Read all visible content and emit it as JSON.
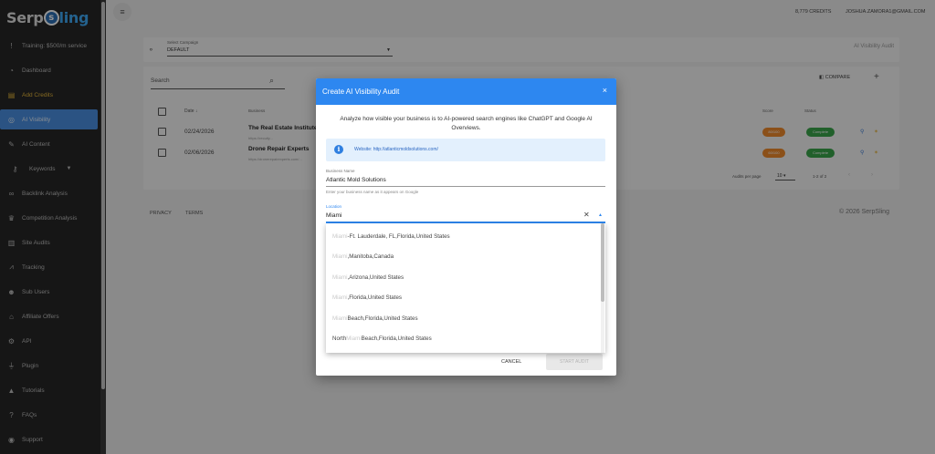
{
  "sidebar": {
    "logo": {
      "pre": "Serp",
      "mid": "s",
      "post": "ling"
    },
    "items": [
      {
        "label": "Training: $500/m service",
        "icon": "exclamation-icon"
      },
      {
        "label": "Dashboard",
        "icon": "dashboard-icon"
      },
      {
        "label": "Add Credits",
        "icon": "coins-icon"
      },
      {
        "label": "AI Visibility",
        "icon": "ai-visibility-icon"
      },
      {
        "label": "AI Content",
        "icon": "pencil-icon"
      },
      {
        "label": "Keywords",
        "icon": "key-icon"
      },
      {
        "label": "Backlink Analysis",
        "icon": "link-icon"
      },
      {
        "label": "Competition Analysis",
        "icon": "trophy-icon"
      },
      {
        "label": "Site Audits",
        "icon": "clipboard-icon"
      },
      {
        "label": "Tracking",
        "icon": "chart-icon"
      },
      {
        "label": "Sub Users",
        "icon": "users-icon"
      },
      {
        "label": "Affiliate Offers",
        "icon": "gift-icon"
      },
      {
        "label": "API",
        "icon": "gear-icon"
      },
      {
        "label": "Plugin",
        "icon": "plug-icon"
      },
      {
        "label": "Tutorials",
        "icon": "graduation-cap-icon"
      },
      {
        "label": "FAQs",
        "icon": "question-icon"
      },
      {
        "label": "Support",
        "icon": "support-icon"
      }
    ]
  },
  "topbar": {
    "credits": "8,779 CREDITS",
    "user": "JOSHUA.ZAMORA1@GMAIL.COM"
  },
  "campaign": {
    "label": "Select Campaign",
    "value": "DEFAULT",
    "page_title": "AI Visibility Audit"
  },
  "table": {
    "search_label": "Search",
    "compare_label": "COMPARE",
    "headers": {
      "date": "Date",
      "business": "Business",
      "score": "Score",
      "status": "Status"
    },
    "rows": [
      {
        "date": "02/24/2026",
        "business": "The Real Estate Institute",
        "sub": "https://recuity...",
        "score": "80/100",
        "status": "Complete"
      },
      {
        "date": "02/06/2026",
        "business": "Drone Repair Experts",
        "sub": "https://dronerepairexperts.com/...",
        "score": "60/100",
        "status": "Complete"
      }
    ],
    "pager": {
      "label": "Audits per page",
      "per_page": "10",
      "count": "1-2 of 2"
    }
  },
  "footer": {
    "privacy": "PRIVACY",
    "terms": "TERMS",
    "copyright": "© 2026 SerpSling"
  },
  "modal": {
    "title": "Create AI Visibility Audit",
    "description": "Analyze how visible your business is to AI-powered search engines like ChatGPT and Google AI Overviews.",
    "website": "Website: http://atlanticmoldsolutions.com/",
    "business_label": "Business Name",
    "business_value": "Atlantic Mold Solutions",
    "business_hint": "Enter your business name as it appears on Google",
    "location_label": "Location",
    "location_value": "Miami",
    "cancel": "CANCEL",
    "start": "START AUDIT",
    "options": [
      {
        "pre": "",
        "hl": "Miami",
        "post": "-Ft. Lauderdale, FL,Florida,United States"
      },
      {
        "pre": "",
        "hl": "Miami",
        "post": ",Manitoba,Canada"
      },
      {
        "pre": "",
        "hl": "Miami",
        "post": ",Arizona,United States"
      },
      {
        "pre": "",
        "hl": "Miami",
        "post": ",Florida,United States"
      },
      {
        "pre": "",
        "hl": "Miami",
        "post": " Beach,Florida,United States"
      },
      {
        "pre": "North ",
        "hl": "Miami",
        "post": " Beach,Florida,United States"
      }
    ]
  },
  "colors": {
    "accent": "#2d87f0",
    "sidebar": "#262626",
    "score": "#f08a2b",
    "status": "#3aa64b"
  }
}
